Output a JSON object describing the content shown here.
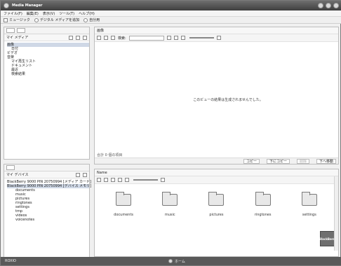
{
  "window": {
    "title": "Media Manager"
  },
  "menus": [
    "ファイル(F)",
    "編集(E)",
    "表示(V)",
    "ツール(T)",
    "ヘルプ(H)"
  ],
  "toolbar": {
    "items": [
      "ミュージック",
      "デジタル メディアを追加",
      "自分用"
    ]
  },
  "left_top": {
    "title": "マイ メディア",
    "tree": [
      {
        "label": "画像",
        "level": 0,
        "selected": true
      },
      {
        "label": "日付",
        "level": 1
      },
      {
        "label": "ビデオ",
        "level": 0
      },
      {
        "label": "音楽",
        "level": 0
      },
      {
        "label": "マイ再生リスト",
        "level": 1
      },
      {
        "label": "ドキュメント",
        "level": 1
      },
      {
        "label": "最近",
        "level": 1
      },
      {
        "label": "検索結果",
        "level": 1
      }
    ]
  },
  "left_bottom": {
    "title": "マイ デバイス",
    "tree": [
      {
        "label": "BlackBerry 9000 PIN 20750994 [メディア カード]",
        "level": 0
      },
      {
        "label": "BlackBerry 9000 PIN 20750994 [デバイス メモリ]",
        "level": 0,
        "selected": true
      },
      {
        "label": "documents",
        "level": 1
      },
      {
        "label": "music",
        "level": 1
      },
      {
        "label": "pictures",
        "level": 1
      },
      {
        "label": "ringtones",
        "level": 1
      },
      {
        "label": "settings",
        "level": 1
      },
      {
        "label": "tmp",
        "level": 1
      },
      {
        "label": "videos",
        "level": 1
      },
      {
        "label": "voicenotes",
        "level": 1
      }
    ]
  },
  "right_top": {
    "title": "画像",
    "search_placeholder": "検索:",
    "empty_message": "このビューの結果は生成されませんでした。",
    "count_text": "合計 0 個の項目",
    "nav_buttons": [
      {
        "label": "コピー",
        "disabled": false
      },
      {
        "label": "下にコピー",
        "disabled": false
      },
      {
        "label": "削除",
        "disabled": true
      },
      {
        "label": "下へ移動",
        "disabled": false
      }
    ]
  },
  "right_bottom": {
    "title": "Name",
    "folders": [
      "documents",
      "music",
      "pictures",
      "ringtones",
      "settings"
    ],
    "badge_label": "BlackBerry"
  },
  "status": {
    "left": "ROXIO",
    "center": "ホーム"
  }
}
